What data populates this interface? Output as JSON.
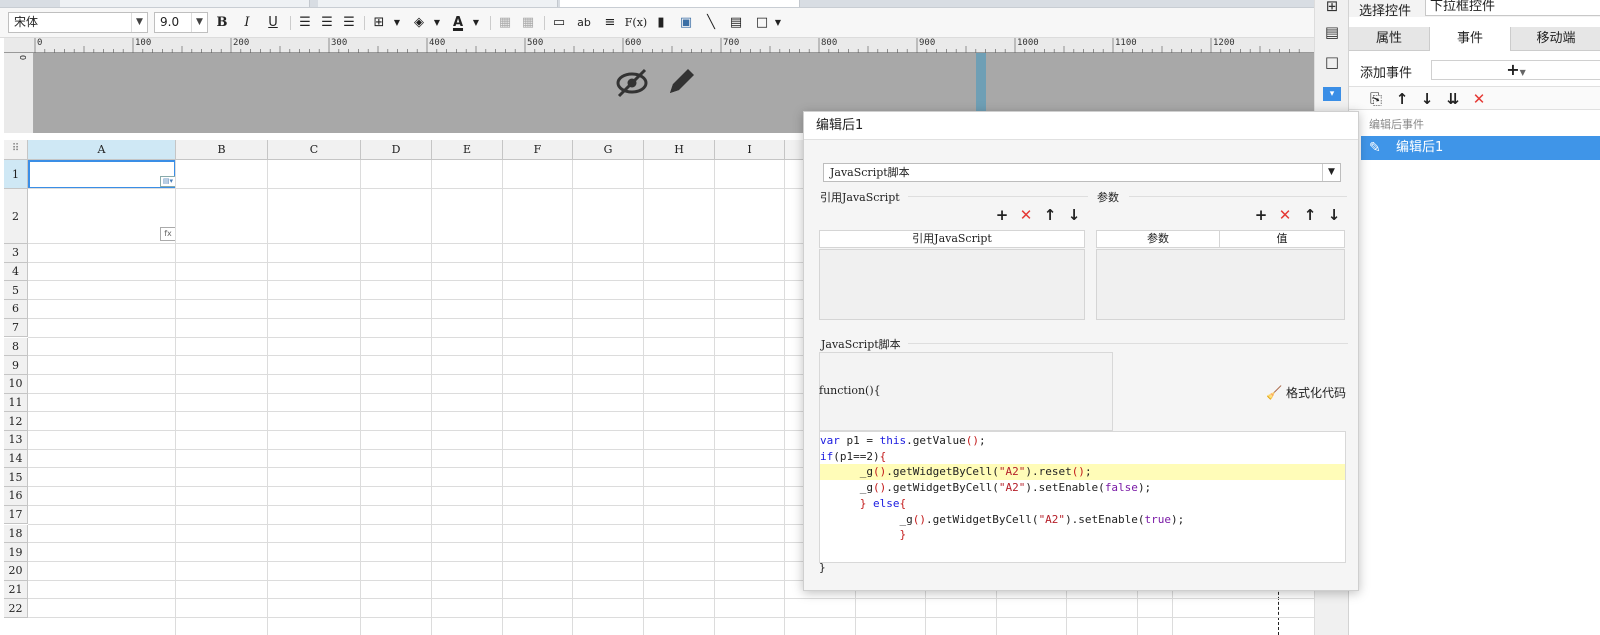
{
  "toolbar": {
    "font_family": "宋体",
    "font_size": "9.0",
    "bold": "B",
    "italic": "I",
    "underline": "U",
    "font_color_glyph": "A",
    "abc_glyph": "ab",
    "formula_glyph": "F(x)"
  },
  "ruler": {
    "ticks": [
      "0",
      "100",
      "200",
      "300",
      "400",
      "500",
      "600",
      "700",
      "800",
      "900",
      "1000",
      "1100",
      "1200"
    ]
  },
  "grid": {
    "corner": "⠿",
    "columns": [
      "A",
      "B",
      "C",
      "D",
      "E",
      "F",
      "G",
      "H",
      "I"
    ],
    "rows": [
      "1",
      "2",
      "3",
      "4",
      "5",
      "6",
      "7",
      "8",
      "9",
      "10",
      "11",
      "12",
      "13",
      "14",
      "15",
      "16",
      "17",
      "18",
      "19",
      "20",
      "21",
      "22"
    ],
    "cell_icon_fx": "fx"
  },
  "right_panel": {
    "select_label": "选择控件",
    "select_value": "下拉框控件",
    "tabs": [
      "属性",
      "事件",
      "移动端"
    ],
    "active_tab": "事件",
    "add_event_label": "添加事件",
    "add_icon": "+",
    "event_group_header": "编辑后事件",
    "event_item": "编辑后1"
  },
  "dialog": {
    "title": "编辑后1",
    "type_select": "JavaScript脚本",
    "ref_js_label": "引用JavaScript",
    "params_label": "参数",
    "ref_js_column": "引用JavaScript",
    "param_column": "参数",
    "value_column": "值",
    "script_label": "JavaScript脚本",
    "function_header": "function(){",
    "format_button": "格式化代码",
    "closing_brace": "}",
    "code_lines": [
      "var p1 = this.getValue();",
      "if(p1==2){",
      "      _g().getWidgetByCell(\"A2\").reset();",
      "      _g().getWidgetByCell(\"A2\").setEnable(false);",
      "      } else{",
      "            _g().getWidgetByCell(\"A2\").setEnable(true);",
      "            }"
    ],
    "highlighted_line": 2
  },
  "colors": {
    "selection_blue": "#3a8ee6",
    "event_item_bg": "#3f95e8",
    "delete_red": "#e53935",
    "code_highlight": "#fffcb8"
  }
}
